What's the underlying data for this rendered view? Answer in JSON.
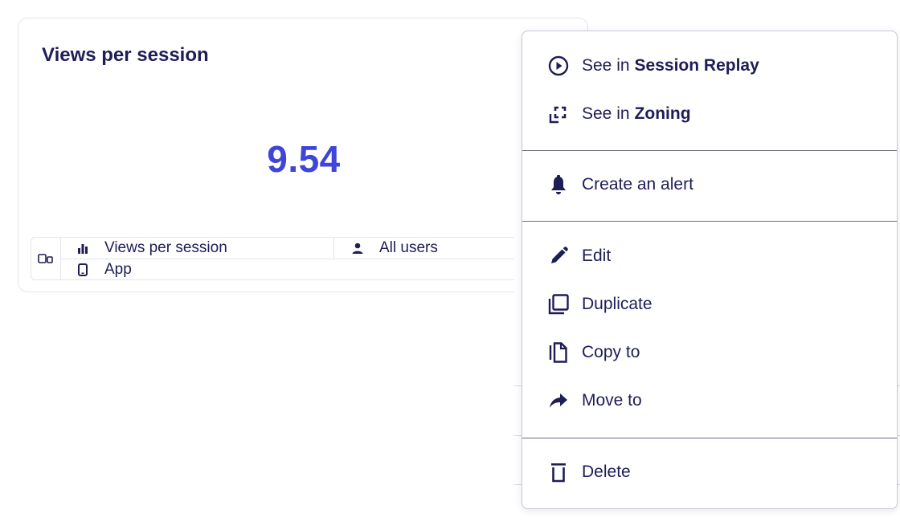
{
  "card": {
    "title": "Views per session",
    "value": "9.54",
    "meta": {
      "metric": "Views per session",
      "segment": "All users",
      "platform": "App"
    }
  },
  "menu": {
    "session_replay": {
      "prefix": "See in",
      "target": "Session Replay"
    },
    "zoning": {
      "prefix": "See in",
      "target": "Zoning"
    },
    "create_alert": "Create an alert",
    "edit": "Edit",
    "duplicate": "Duplicate",
    "copy_to": "Copy to",
    "move_to": "Move to",
    "delete": "Delete"
  },
  "colors": {
    "primary_text": "#1e1d56",
    "metric_value": "#3f45d8",
    "border": "#e4e4ec"
  },
  "icons": {
    "session_replay": "play-circle-icon",
    "zoning": "zoning-frame-icon",
    "create_alert": "bell-icon",
    "edit": "pencil-icon",
    "duplicate": "duplicate-icon",
    "copy_to": "copy-icon",
    "move_to": "share-arrow-icon",
    "delete": "trash-icon",
    "devices": "devices-icon",
    "metric": "bar-chart-icon",
    "segment": "user-icon",
    "platform": "mobile-icon"
  }
}
